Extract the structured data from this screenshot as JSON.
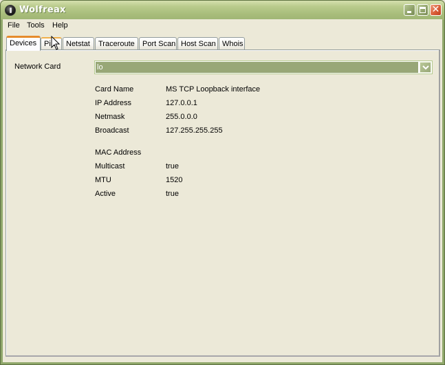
{
  "window": {
    "title": "Wolfreax",
    "icon": "app-logo-icon",
    "controls": [
      "minimize-icon",
      "maximize-icon",
      "close-icon"
    ]
  },
  "menubar": {
    "items": [
      {
        "label": "File"
      },
      {
        "label": "Tools"
      },
      {
        "label": "Help"
      }
    ]
  },
  "tabs": [
    {
      "label": "Devices",
      "active": true
    },
    {
      "label": "Ping",
      "visible_text": "Pin"
    },
    {
      "label": "Netstat"
    },
    {
      "label": "Traceroute"
    },
    {
      "label": "Port Scan"
    },
    {
      "label": "Host Scan"
    },
    {
      "label": "Whois"
    }
  ],
  "devices": {
    "network_card_label": "Network Card",
    "network_card_value": "lo",
    "details": [
      {
        "key": "Card Name",
        "value": "MS TCP Loopback interface"
      },
      {
        "key": "IP Address",
        "value": "127.0.0.1"
      },
      {
        "key": "Netmask",
        "value": "255.0.0.0"
      },
      {
        "key": "Broadcast",
        "value": "127.255.255.255"
      },
      {
        "key": "MAC Address",
        "value": ""
      },
      {
        "key": "Multicast",
        "value": "true"
      },
      {
        "key": "MTU",
        "value": "1520"
      },
      {
        "key": "Active",
        "value": "true"
      }
    ]
  },
  "colors": {
    "titlebar": "#a8bd7b",
    "window_bg": "#ece9d8",
    "active_tab_accent": "#e68b2c",
    "combo_selection": "#98a777"
  }
}
